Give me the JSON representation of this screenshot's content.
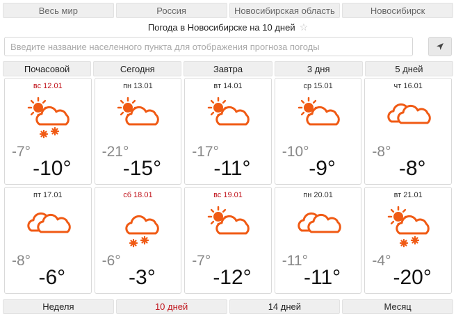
{
  "top_nav": [
    "Весь мир",
    "Россия",
    "Новосибирская область",
    "Новосибирск"
  ],
  "title": "Погода в Новосибирске на 10 дней",
  "search": {
    "placeholder": "Введите название населенного пункта для отображения прогноза погоды",
    "value": ""
  },
  "period_tabs": [
    "Почасовой",
    "Сегодня",
    "Завтра",
    "3 дня",
    "5 дней"
  ],
  "days": [
    {
      "date": "вс 12.01",
      "weekend": true,
      "tmin": "-7°",
      "tmax": "-10°",
      "icon": "sun-cloud-snow-icon"
    },
    {
      "date": "пн 13.01",
      "weekend": false,
      "tmin": "-21°",
      "tmax": "-15°",
      "icon": "sun-cloud-icon"
    },
    {
      "date": "вт 14.01",
      "weekend": false,
      "tmin": "-17°",
      "tmax": "-11°",
      "icon": "sun-cloud-icon"
    },
    {
      "date": "ср 15.01",
      "weekend": false,
      "tmin": "-10°",
      "tmax": "-9°",
      "icon": "sun-cloud-icon"
    },
    {
      "date": "чт 16.01",
      "weekend": false,
      "tmin": "-8°",
      "tmax": "-8°",
      "icon": "cloudy-icon"
    },
    {
      "date": "пт 17.01",
      "weekend": false,
      "tmin": "-8°",
      "tmax": "-6°",
      "icon": "cloudy-icon"
    },
    {
      "date": "сб 18.01",
      "weekend": true,
      "tmin": "-6°",
      "tmax": "-3°",
      "icon": "cloud-snow-icon"
    },
    {
      "date": "вс 19.01",
      "weekend": true,
      "tmin": "-7°",
      "tmax": "-12°",
      "icon": "sun-cloud-icon"
    },
    {
      "date": "пн 20.01",
      "weekend": false,
      "tmin": "-11°",
      "tmax": "-11°",
      "icon": "cloudy-icon"
    },
    {
      "date": "вт 21.01",
      "weekend": false,
      "tmin": "-4°",
      "tmax": "-20°",
      "icon": "sun-cloud-snow-icon"
    }
  ],
  "bottom_tabs": [
    {
      "label": "Неделя",
      "active": false
    },
    {
      "label": "10 дней",
      "active": true
    },
    {
      "label": "14 дней",
      "active": false
    },
    {
      "label": "Месяц",
      "active": false
    }
  ],
  "colors": {
    "icon": "#f05a14",
    "weekend": "#c0121a"
  }
}
